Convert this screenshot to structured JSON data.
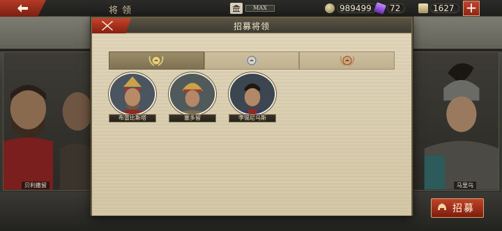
{
  "topbar": {
    "title": "将领",
    "museum_level": "MAX",
    "silver": "989499",
    "gems": "72",
    "scrolls": "1627",
    "colors": {
      "accent": "#b33a26"
    }
  },
  "background": {
    "left_general_name": "贝利撒留",
    "right_general_name": "马里乌",
    "recruit_label": "招募"
  },
  "modal": {
    "title": "招募将领",
    "tabs": [
      {
        "name": "gold-tier",
        "active": true
      },
      {
        "name": "silver-tier",
        "active": false
      },
      {
        "name": "bronze-tier",
        "active": false
      }
    ],
    "heroes": [
      {
        "name": "布雷比斯塔",
        "icon": "hero-portrait"
      },
      {
        "name": "塞多留",
        "icon": "hero-portrait"
      },
      {
        "name": "李锡尼乌斯",
        "icon": "hero-portrait"
      }
    ]
  }
}
